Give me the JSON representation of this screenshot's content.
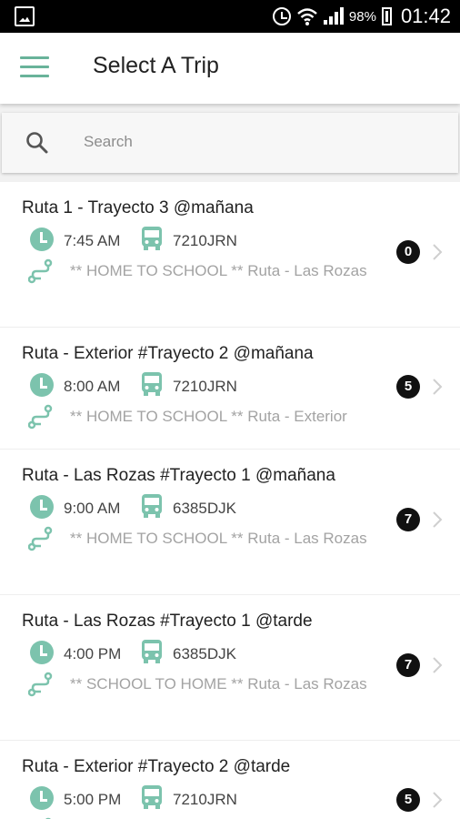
{
  "status_bar": {
    "battery": "98%",
    "time": "01:42"
  },
  "app_bar": {
    "title": "Select A Trip",
    "menu_icon": "hamburger-menu-icon"
  },
  "search": {
    "placeholder": "Search",
    "icon": "search-icon"
  },
  "colors": {
    "accent": "#69b39a",
    "icon_fill": "#7cc3ad",
    "badge_bg": "#111111",
    "secondary_text": "#a3a3a3"
  },
  "trips": [
    {
      "name": "Ruta 1 - Trayecto 3 @mañana",
      "time": "7:45 AM",
      "plate": "7210JRN",
      "description": "** HOME TO SCHOOL ** Ruta - Las Rozas",
      "count": "0"
    },
    {
      "name": "Ruta - Exterior #Trayecto 2 @mañana",
      "time": "8:00 AM",
      "plate": "7210JRN",
      "description": "** HOME TO SCHOOL ** Ruta - Exterior",
      "count": "5"
    },
    {
      "name": "Ruta - Las Rozas #Trayecto 1 @mañana",
      "time": "9:00 AM",
      "plate": "6385DJK",
      "description": "** HOME TO SCHOOL ** Ruta - Las Rozas",
      "count": "7"
    },
    {
      "name": "Ruta - Las Rozas #Trayecto 1 @tarde",
      "time": "4:00 PM",
      "plate": "6385DJK",
      "description": "** SCHOOL TO HOME ** Ruta - Las Rozas",
      "count": "7"
    },
    {
      "name": "Ruta - Exterior #Trayecto 2 @tarde",
      "time": "5:00 PM",
      "plate": "7210JRN",
      "description": "",
      "count": "5"
    }
  ]
}
